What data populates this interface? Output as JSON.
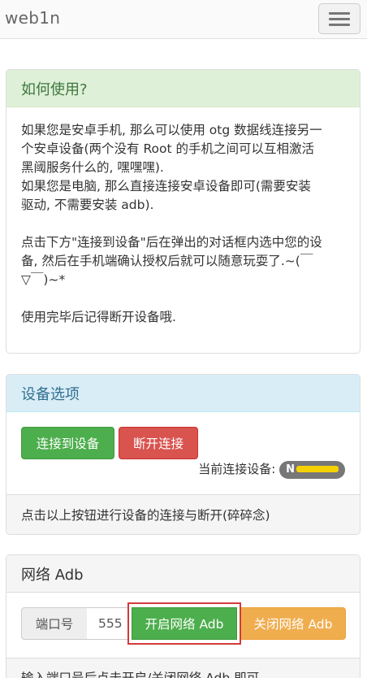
{
  "navbar": {
    "brand": "web1n"
  },
  "howto": {
    "title": "如何使用?",
    "lines": [
      "如果您是安卓手机, 那么可以使用 otg 数据线连接另一",
      "个安卓设备(两个没有 Root 的手机之间可以互相激活",
      "黑阈服务什么的, 嘿嘿嘿).",
      "如果您是电脑, 那么直接连接安卓设备即可(需要安装",
      "驱动, 不需要安装 adb).",
      "点击下方\"连接到设备\"后在弹出的对话框内选中您的设",
      "备, 然后在手机端确认授权后就可以随意玩耍了.~(￣",
      "▽￣)~*",
      "使用完毕后记得断开设备哦."
    ]
  },
  "device": {
    "title": "设备选项",
    "connect_label": "连接到设备",
    "disconnect_label": "断开连接",
    "current_label": "当前连接设备:",
    "current_device_visible": "N",
    "footer": "点击以上按钮进行设备的连接与断开(碎碎念)"
  },
  "adb": {
    "title": "网络 Adb",
    "port_label": "端口号",
    "port_value": "555",
    "enable_label": "开启网络 Adb",
    "disable_label": "关闭网络 Adb",
    "footer": "输入端口号后点击开启/关闭网络 Adb 即可"
  },
  "colors": {
    "success": "#4cae4c",
    "danger": "#d9534f",
    "warning": "#f0ad4e",
    "highlight": "#d23b3b"
  }
}
